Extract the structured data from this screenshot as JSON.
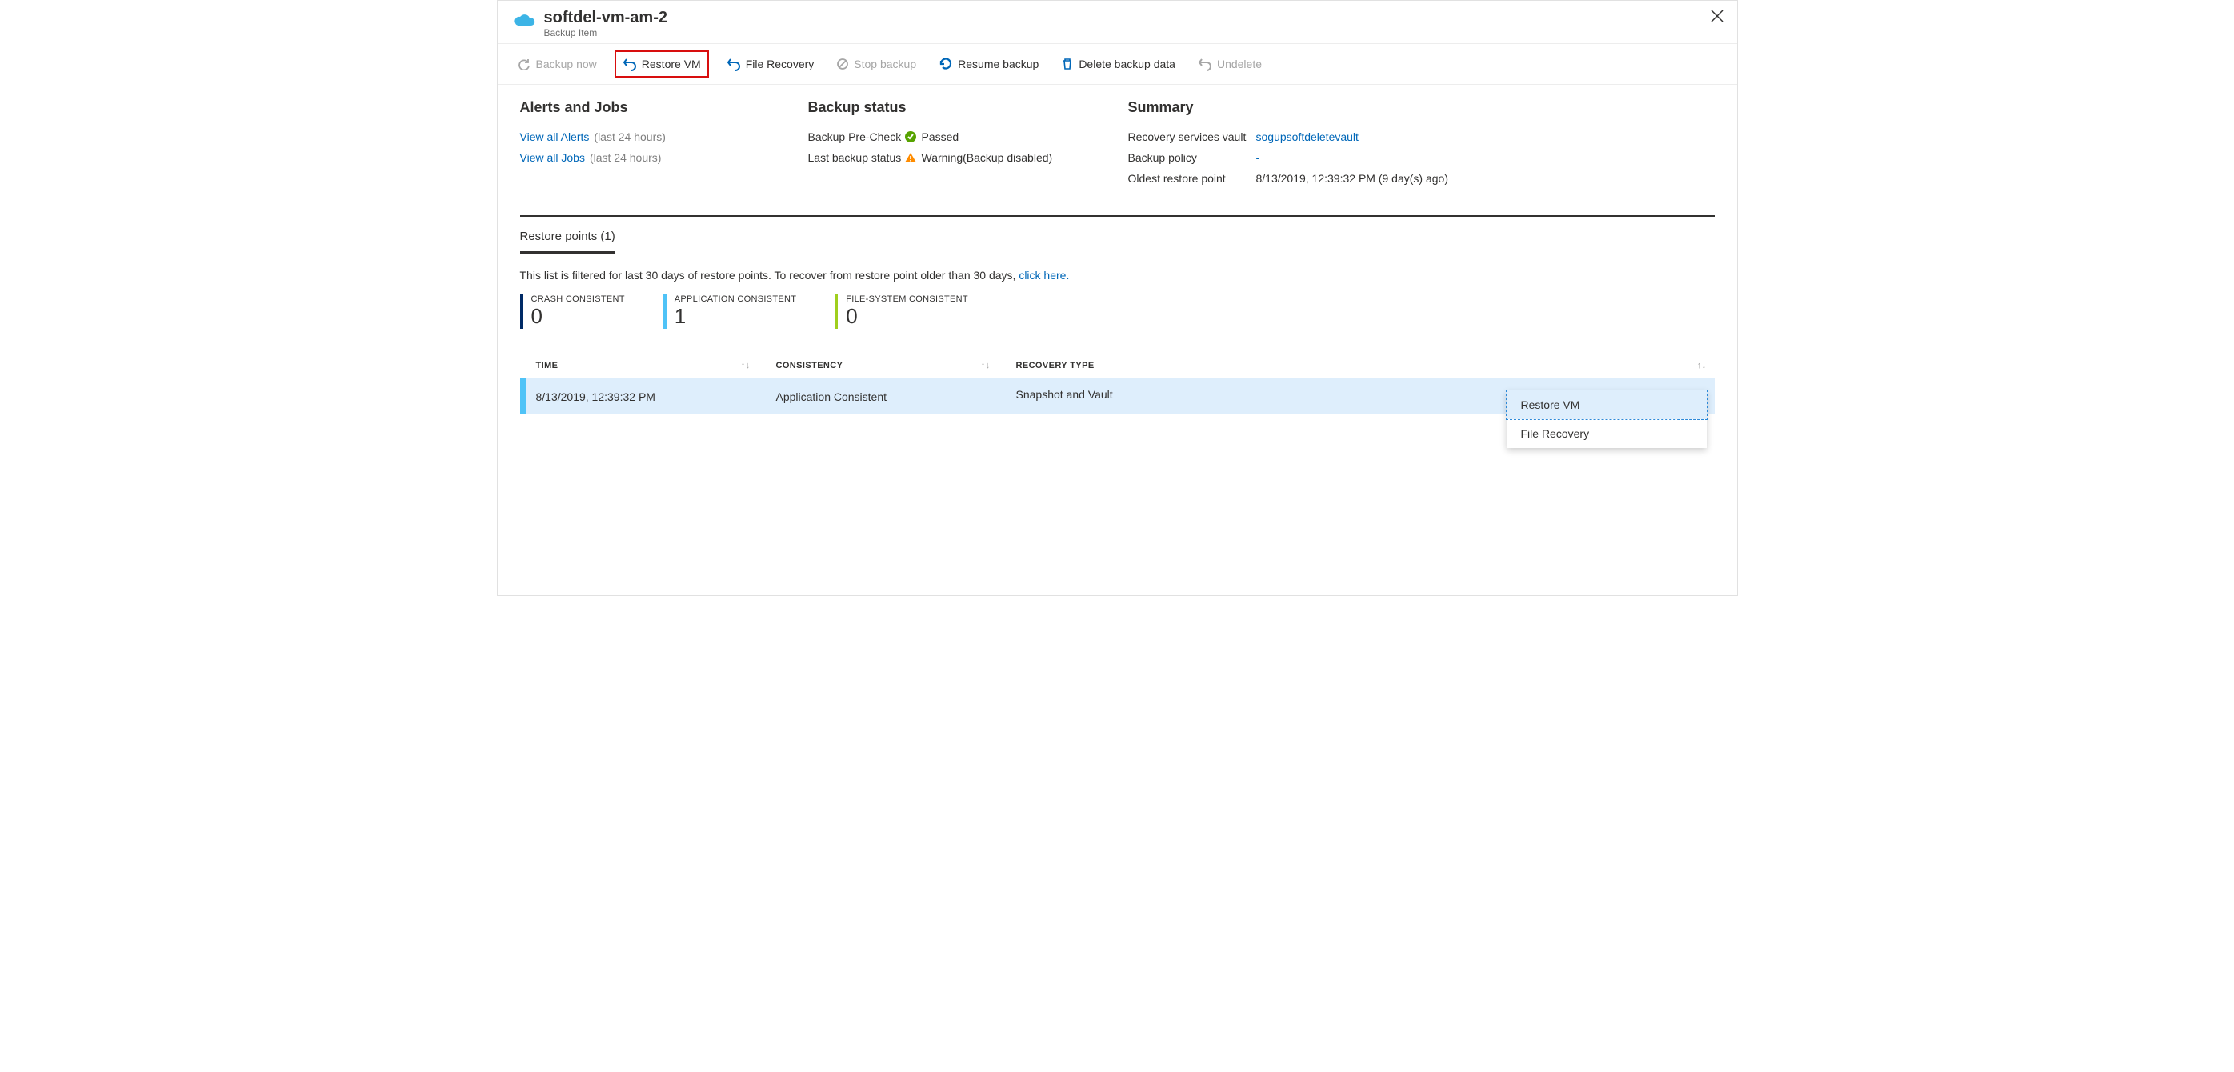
{
  "header": {
    "title": "softdel-vm-am-2",
    "subtitle": "Backup Item"
  },
  "toolbar": {
    "backup_now": "Backup now",
    "restore_vm": "Restore VM",
    "file_recovery": "File Recovery",
    "stop_backup": "Stop backup",
    "resume_backup": "Resume backup",
    "delete_backup_data": "Delete backup data",
    "undelete": "Undelete"
  },
  "sections": {
    "alerts_jobs": {
      "heading": "Alerts and Jobs",
      "view_alerts": "View all Alerts",
      "alerts_suffix": "(last 24 hours)",
      "view_jobs": "View all Jobs",
      "jobs_suffix": "(last 24 hours)"
    },
    "backup_status": {
      "heading": "Backup status",
      "precheck_label": "Backup Pre-Check",
      "precheck_value": "Passed",
      "last_label": "Last backup status",
      "last_value": "Warning(Backup disabled)"
    },
    "summary": {
      "heading": "Summary",
      "vault_label": "Recovery services vault",
      "vault_value": "sogupsoftdeletevault",
      "policy_label": "Backup policy",
      "policy_value": "-",
      "oldest_label": "Oldest restore point",
      "oldest_value": "8/13/2019, 12:39:32 PM (9 day(s) ago)"
    }
  },
  "tabs": {
    "restore_points": "Restore points (1)"
  },
  "filter_note_prefix": "This list is filtered for last 30 days of restore points. To recover from restore point older than 30 days, ",
  "filter_note_link": "click here.",
  "counters": {
    "crash": {
      "label": "CRASH CONSISTENT",
      "value": "0"
    },
    "app": {
      "label": "APPLICATION CONSISTENT",
      "value": "1"
    },
    "fs": {
      "label": "FILE-SYSTEM CONSISTENT",
      "value": "0"
    }
  },
  "table": {
    "cols": {
      "time": "TIME",
      "consistency": "CONSISTENCY",
      "recovery": "RECOVERY TYPE"
    },
    "rows": [
      {
        "time": "8/13/2019, 12:39:32 PM",
        "consistency": "Application Consistent",
        "recovery": "Snapshot and Vault"
      }
    ]
  },
  "ctx": {
    "restore_vm": "Restore VM",
    "file_recovery": "File Recovery"
  }
}
